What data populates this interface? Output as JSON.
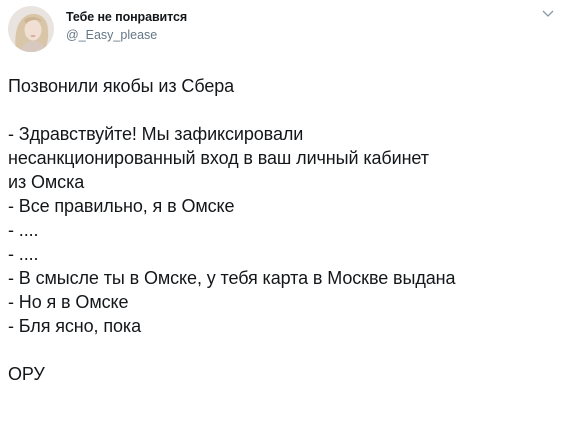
{
  "tweet": {
    "author": {
      "display_name": "Тебе не понравится",
      "username": "@_Easy_please"
    },
    "menu_icon": "chevron-down-icon",
    "lines": {
      "l0": "Позвонили якобы из Сбера",
      "l1": "- Здравствуйте! Мы зафиксировали",
      "l2": "несанкционированный вход в ваш личный кабинет",
      "l3": "из Омска",
      "l4": "- Все правильно, я в Омске",
      "l5": "- ....",
      "l6": "- ....",
      "l7": "- В смысле ты в Омске, у тебя карта в Москве выдана",
      "l8": "- Но я в Омске",
      "l9": "- Бля ясно, пока",
      "l10": "ОРУ"
    }
  }
}
